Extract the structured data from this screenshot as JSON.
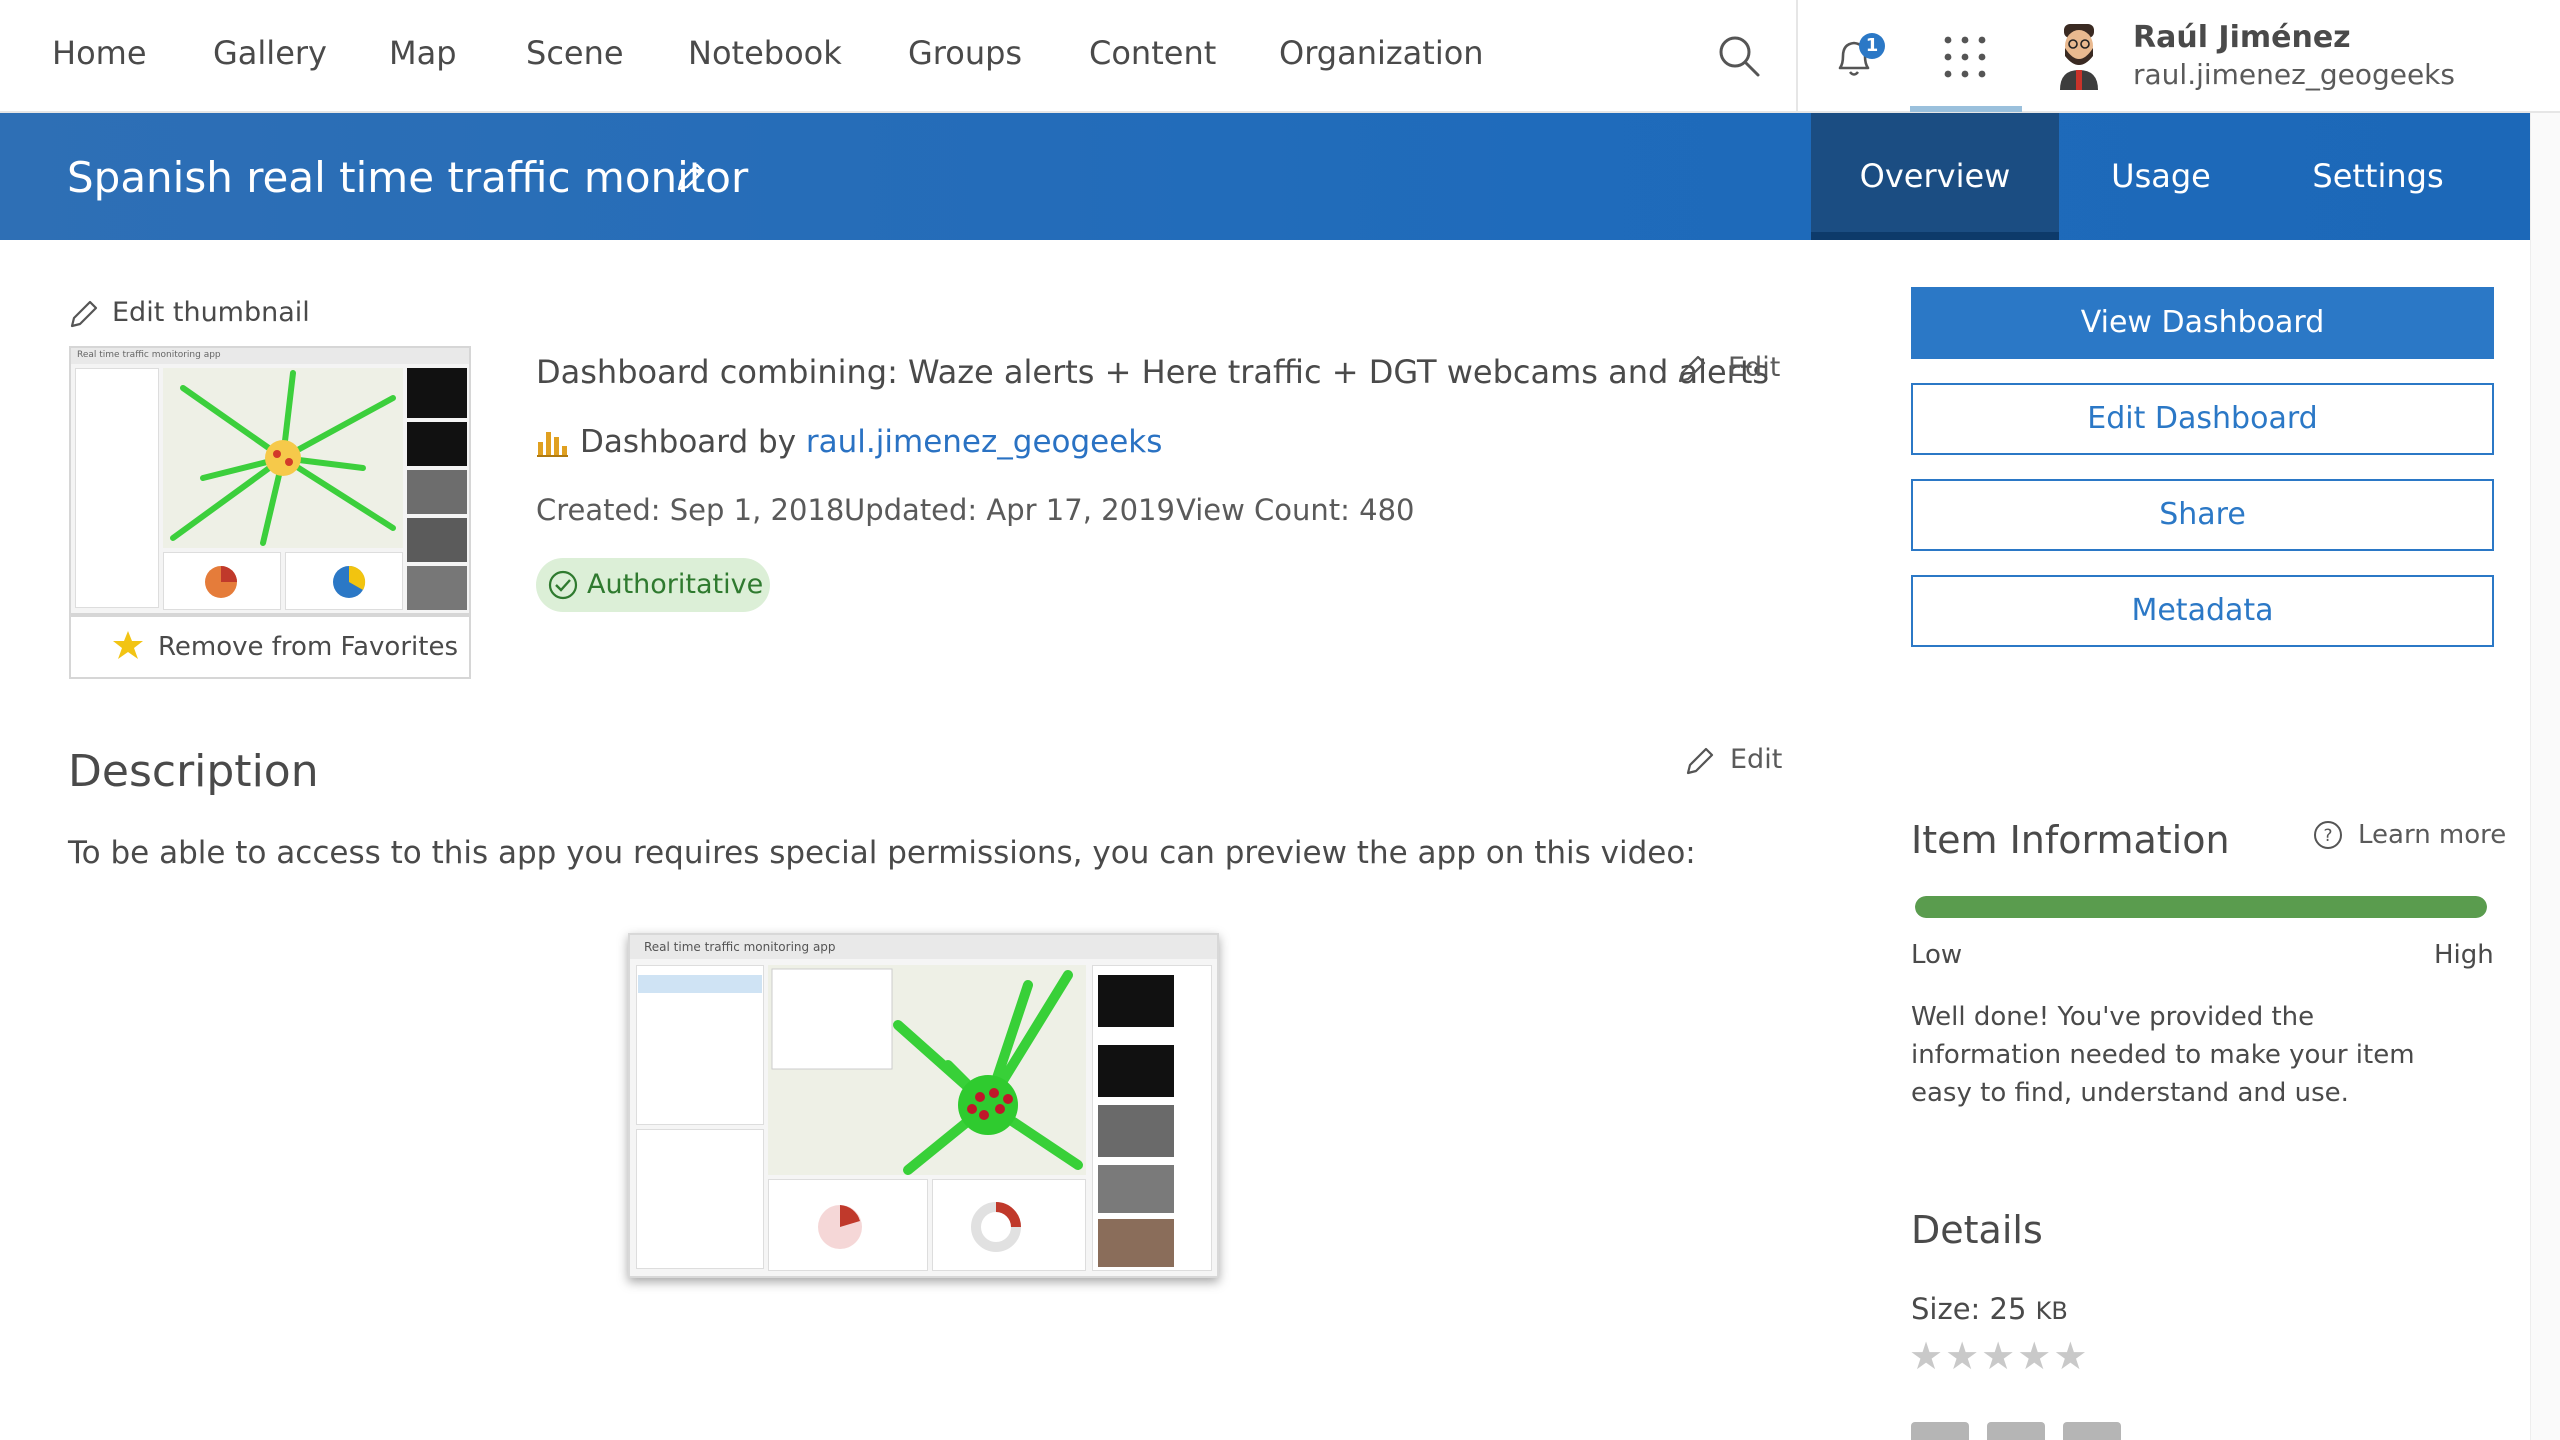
{
  "nav": {
    "items": [
      "Home",
      "Gallery",
      "Map",
      "Scene",
      "Notebook",
      "Groups",
      "Content",
      "Organization"
    ],
    "notification_count": "1"
  },
  "user": {
    "name": "Raúl Jiménez",
    "handle": "raul.jimenez_geogeeks"
  },
  "item": {
    "title": "Spanish real time traffic monitor",
    "summary": "Dashboard combining: Waze alerts + Here traffic + DGT webcams and alerts",
    "type_prefix": "Dashboard by",
    "owner": "raul.jimenez_geogeeks",
    "created": "Created: Sep 1, 2018",
    "updated": "Updated: Apr 17, 2019",
    "view_count": "View Count: 480",
    "badge": "Authoritative"
  },
  "tabs": [
    "Overview",
    "Usage",
    "Settings"
  ],
  "left": {
    "edit_thumbnail": "Edit thumbnail",
    "favorites": "Remove from Favorites",
    "edit": "Edit",
    "thumbnail_caption": "Real time traffic monitoring app"
  },
  "description": {
    "heading": "Description",
    "text": "To be able to access to this app you requires special permissions, you can preview the app on this video:",
    "edit": "Edit",
    "video_caption": "Real time traffic monitoring app"
  },
  "actions": {
    "view": "View Dashboard",
    "edit": "Edit Dashboard",
    "share": "Share",
    "metadata": "Metadata"
  },
  "info": {
    "heading": "Item Information",
    "learn_more": "Learn more",
    "score": 1.0,
    "low": "Low",
    "high": "High",
    "message": "Well done! You've provided the information needed to make your item easy to find, understand and use."
  },
  "details": {
    "heading": "Details",
    "size_label": "Size: 25",
    "size_unit": "KB",
    "rating": 0
  },
  "colors": {
    "brand_blue": "#2b78c6",
    "titlebar": "#1f6bbb",
    "active_tab": "#1b4d82",
    "progress_green": "#5a9c4e",
    "badge_bg": "#dcefd7"
  }
}
